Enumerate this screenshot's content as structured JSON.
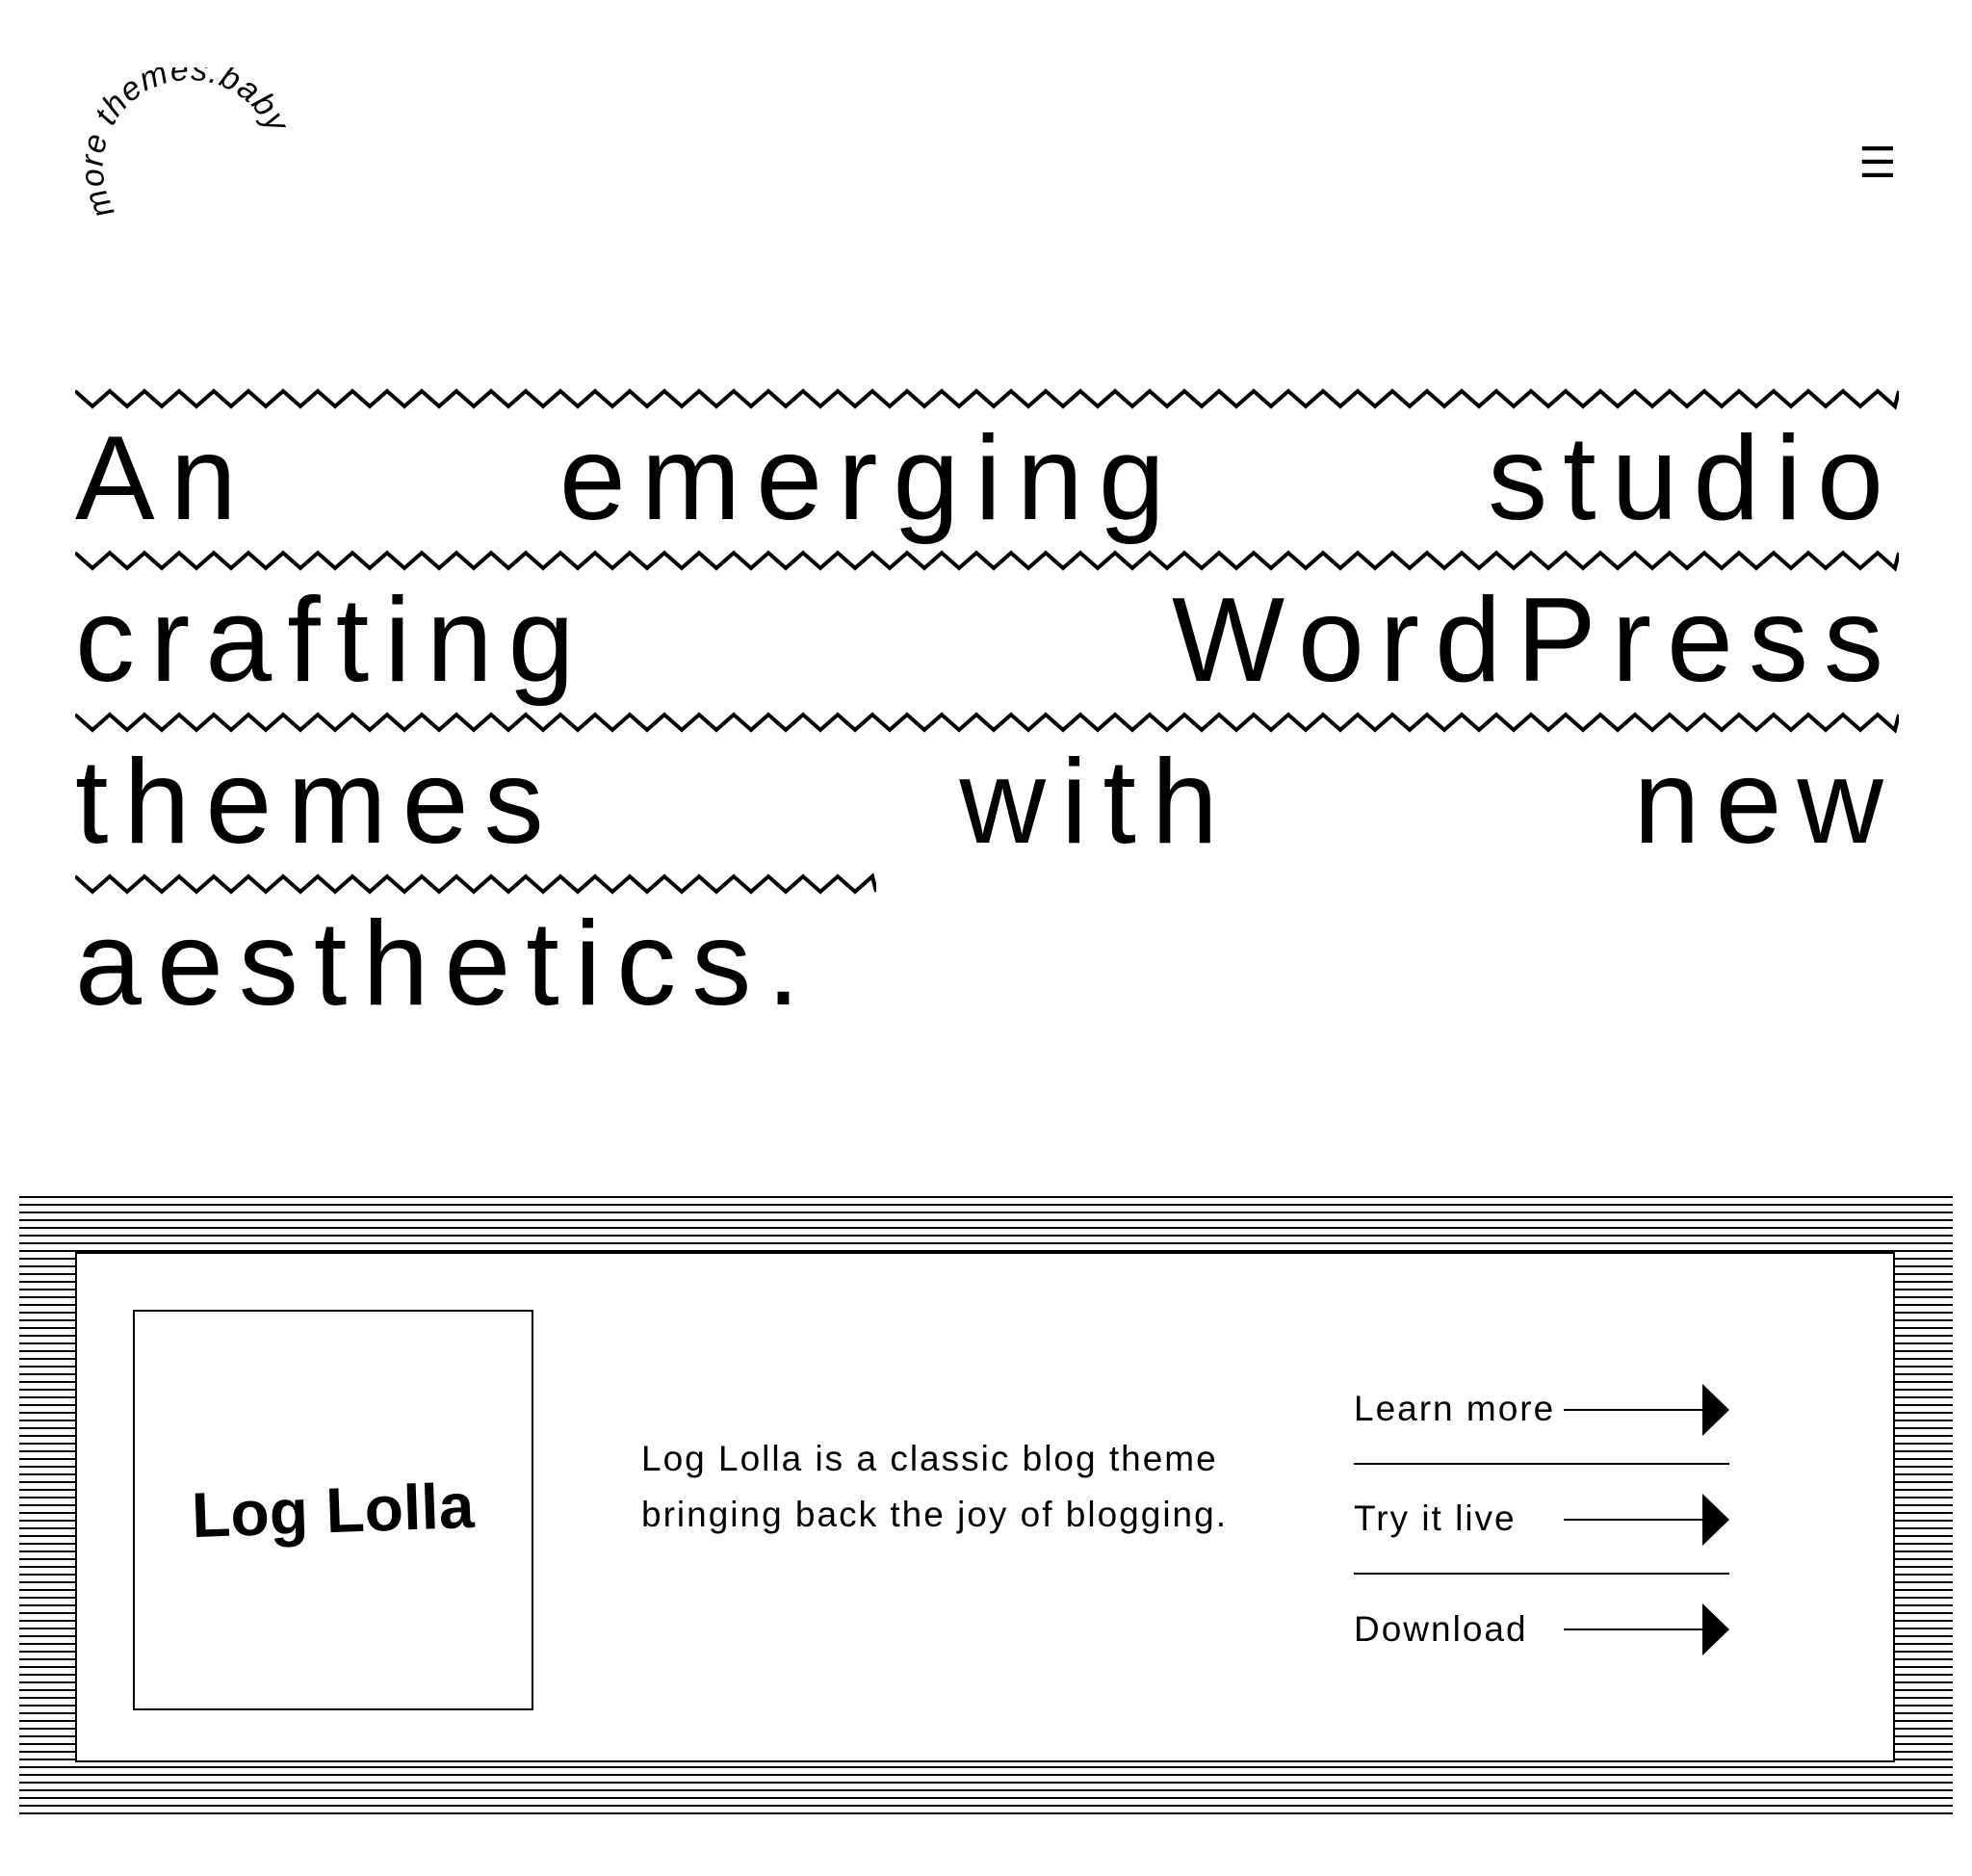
{
  "header": {
    "logo_text": "more themes.baby",
    "menu_icon": "☰",
    "menu_icon_name": "hamburger-menu-icon"
  },
  "hero": {
    "lines": [
      [
        "An",
        "emerging",
        "studio"
      ],
      [
        "crafting",
        "WordPress"
      ],
      [
        "themes",
        "with",
        "new"
      ],
      [
        "aesthetics."
      ]
    ]
  },
  "theme_card": {
    "thumbnail_title": "Log Lolla",
    "description": "Log Lolla is a classic blog theme bringing back the joy of blogging.",
    "actions": [
      {
        "label": "Learn more",
        "icon": "arrow-right-icon"
      },
      {
        "label": "Try it live",
        "icon": "arrow-right-icon"
      },
      {
        "label": "Download",
        "icon": "arrow-right-icon"
      }
    ]
  },
  "colors": {
    "background": "#ffffff",
    "foreground": "#000000"
  }
}
